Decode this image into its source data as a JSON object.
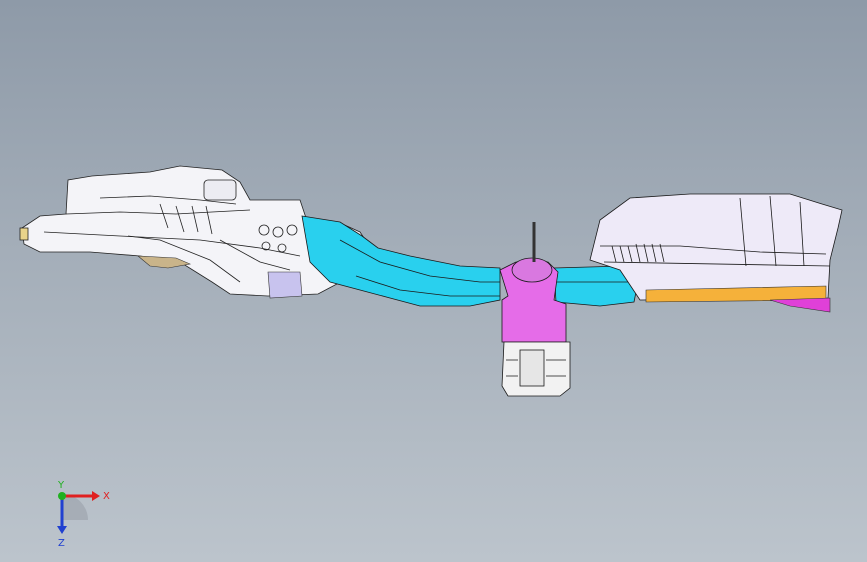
{
  "viewport": {
    "background_top": "#8e9aa8",
    "background_bottom": "#bcc4cc"
  },
  "model": {
    "parts": [
      {
        "name": "rear-frame-rail",
        "color": "#f4f4f8"
      },
      {
        "name": "rear-bracket",
        "color": "#c9b48a"
      },
      {
        "name": "gusset-panel",
        "color": "#c8c3ee"
      },
      {
        "name": "middle-rail-cyan",
        "color": "#29d0ee"
      },
      {
        "name": "mount-bracket-magenta",
        "color": "#e56ce8"
      },
      {
        "name": "lower-bracket",
        "color": "#f2f2f2"
      },
      {
        "name": "front-cover",
        "color": "#eeeaf8"
      },
      {
        "name": "front-strip-orange",
        "color": "#f5b13a"
      },
      {
        "name": "front-strip-magenta",
        "color": "#e040d8"
      }
    ]
  },
  "triad": {
    "x_label": "X",
    "y_label": "Y",
    "z_label": "Z",
    "x_color": "#e02020",
    "y_color": "#20b020",
    "z_color": "#2040d0"
  }
}
